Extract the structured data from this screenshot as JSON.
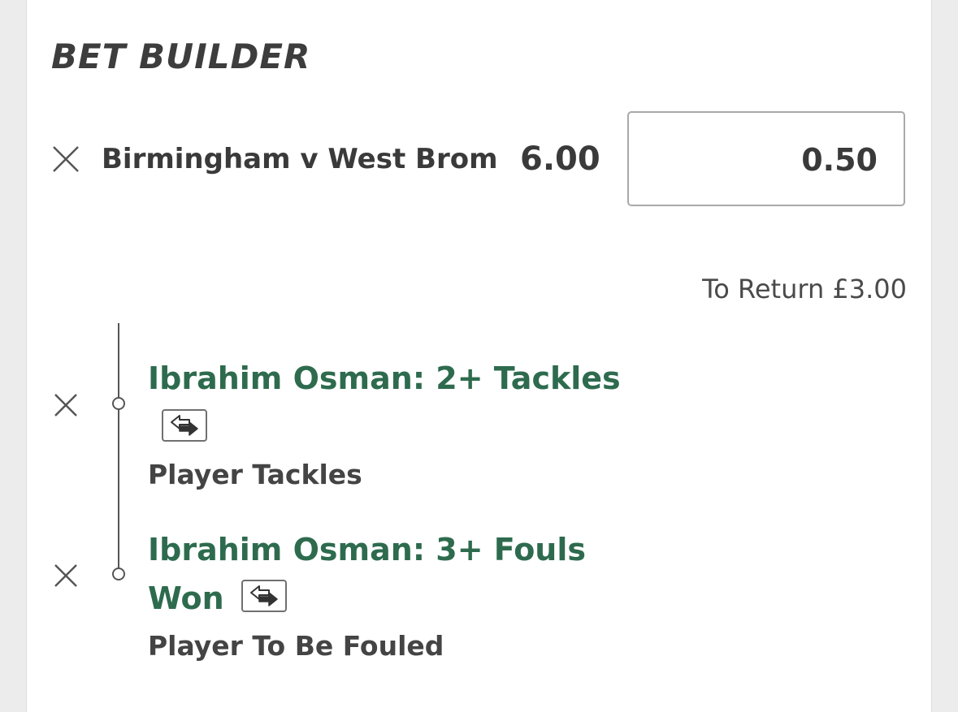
{
  "header": {
    "title": "BET BUILDER"
  },
  "bet": {
    "match": "Birmingham v West Brom",
    "odds": "6.00",
    "stake": "0.50",
    "to_return": "To Return £3.00"
  },
  "selections": [
    {
      "title": "Ibrahim Osman: 2+ Tackles",
      "market": "Player Tackles",
      "icon": "swap-icon"
    },
    {
      "title_line1": "Ibrahim Osman: 3+ Fouls",
      "title_line2": "Won",
      "market": "Player To Be Fouled",
      "icon": "swap-icon"
    }
  ],
  "colors": {
    "selection_green": "#2e6b4e",
    "text_dark": "#3a3a3a"
  }
}
